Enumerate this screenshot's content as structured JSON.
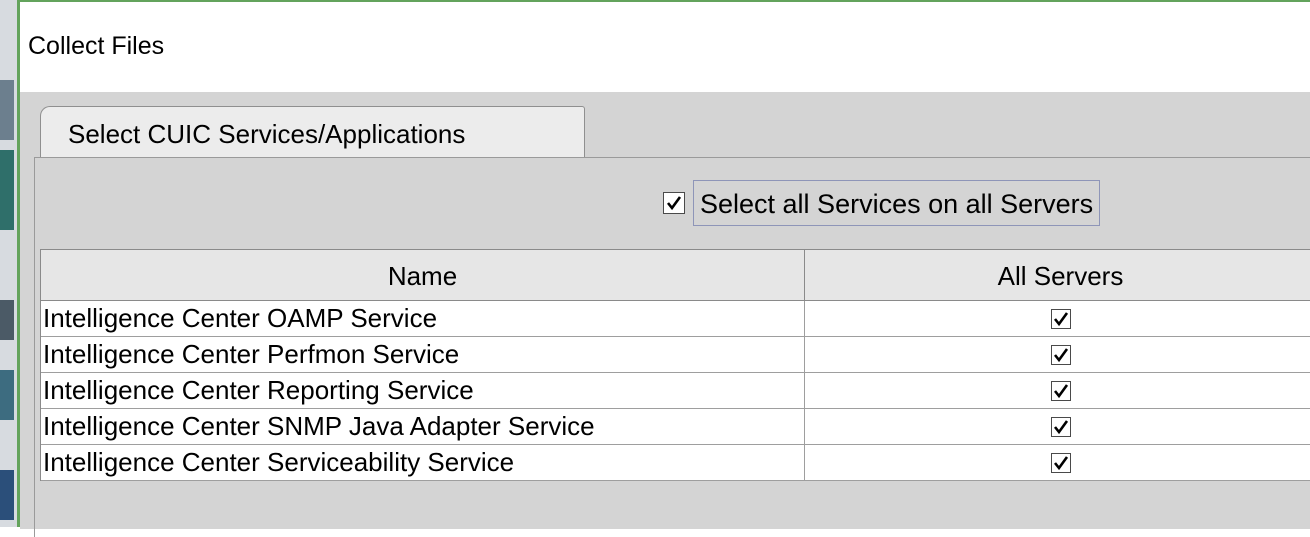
{
  "window": {
    "title": "Collect Files"
  },
  "tab": {
    "label": "Select CUIC Services/Applications"
  },
  "select_all": {
    "label": "Select all Services on all Servers",
    "checked": true
  },
  "table": {
    "columns": [
      "Name",
      "All Servers"
    ],
    "rows": [
      {
        "name": "Intelligence Center OAMP Service",
        "all_servers": true
      },
      {
        "name": "Intelligence Center Perfmon Service",
        "all_servers": true
      },
      {
        "name": "Intelligence Center Reporting Service",
        "all_servers": true
      },
      {
        "name": "Intelligence Center SNMP Java Adapter Service",
        "all_servers": true
      },
      {
        "name": "Intelligence Center Serviceability Service",
        "all_servers": true
      }
    ]
  },
  "colors": {
    "window_border": "#63a35c",
    "client_bg": "#d4d4d4",
    "header_bg": "#e6e6e6",
    "focus_border": "#8e95b8"
  },
  "icons": {
    "checkbox_checked": "check-mark-icon"
  }
}
